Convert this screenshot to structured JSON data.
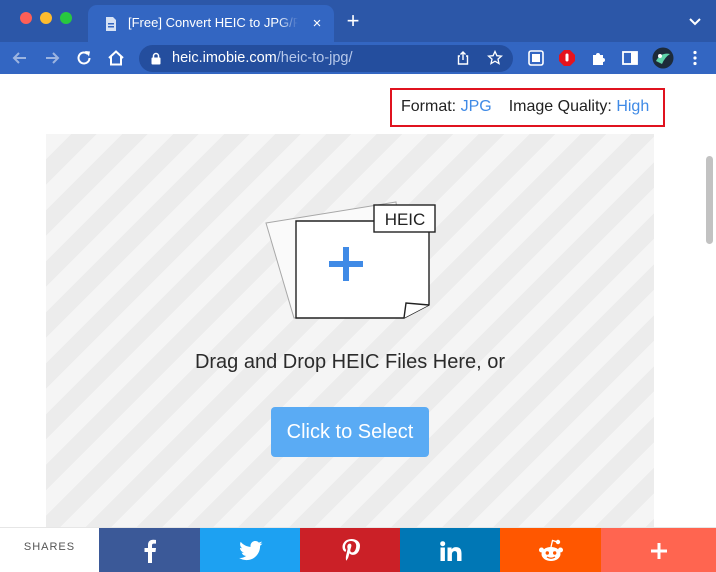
{
  "browser": {
    "tab_title": "[Free] Convert HEIC to JPG/PNG",
    "close_symbol": "×",
    "new_tab_symbol": "+",
    "url_host": "heic.imobie.com",
    "url_path": "/heic-to-jpg/"
  },
  "format_bar": {
    "format_label": "Format:",
    "format_value": "JPG",
    "quality_label": "Image Quality:",
    "quality_value": "High"
  },
  "dropzone": {
    "file_tag": "HEIC",
    "instruction": "Drag and Drop HEIC Files Here, or",
    "select_button": "Click to Select"
  },
  "sharebar": {
    "label": "SHARES",
    "buttons": [
      {
        "network": "facebook",
        "icon": "facebook-icon",
        "color": "#3b5998"
      },
      {
        "network": "twitter",
        "icon": "twitter-icon",
        "color": "#1da1f2"
      },
      {
        "network": "pinterest",
        "icon": "pinterest-icon",
        "color": "#cb2027"
      },
      {
        "network": "linkedin",
        "icon": "linkedin-icon",
        "color": "#0077b5"
      },
      {
        "network": "reddit",
        "icon": "reddit-icon",
        "color": "#ff5700"
      },
      {
        "network": "more",
        "icon": "plus-icon",
        "color": "#ff6550"
      }
    ]
  },
  "colors": {
    "chrome": "#2c57a8",
    "accent_blue": "#3f8ae6",
    "highlight_border": "#e0131f",
    "button": "#5aabf4"
  }
}
